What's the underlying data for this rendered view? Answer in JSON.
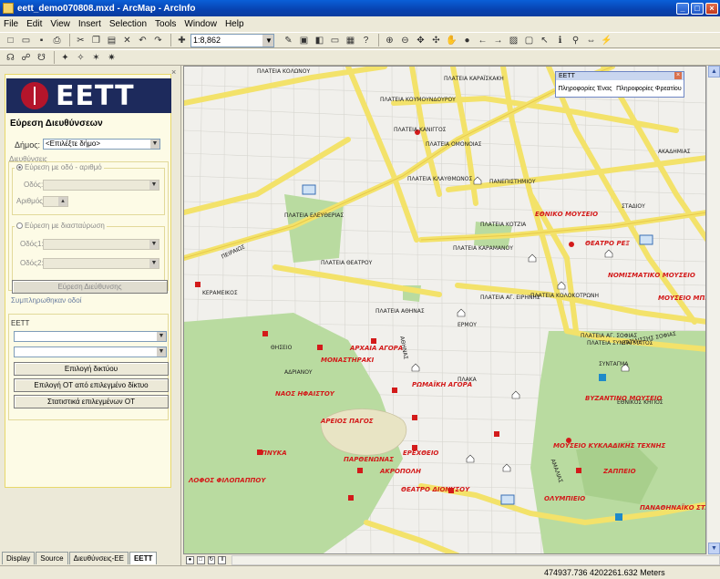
{
  "window": {
    "title": "eett_demo070808.mxd - ArcMap - ArcInfo"
  },
  "menu": [
    "File",
    "Edit",
    "View",
    "Insert",
    "Selection",
    "Tools",
    "Window",
    "Help"
  ],
  "toolbar": {
    "scale_value": "1:8,862"
  },
  "panel": {
    "logo_text": "EETT",
    "search_title": "Εύρεση Διευθύνσεων",
    "dimos_label": "Δήμος:",
    "dimos_value": "<Επιλέξτε δήμο>",
    "addresses_legend": "Διευθύνσεις",
    "by_street_legend": "Εύρεση με οδό - αριθμό",
    "odos_label": "Οδός:",
    "arithmos_label": "Αριθμός:",
    "by_cross_legend": "Εύρεση με διασταύρωση",
    "odos1_label": "Οδός1:",
    "odos2_label": "Οδός2:",
    "search_button": "Εύρεση Διεύθυνσης",
    "complete_link": "Συμπληρωθηκαν οδοί",
    "eett_section": "ΕΕΤΤ",
    "btn_network": "Επιλογή δικτύου",
    "btn_ot": "Επιλογή ΟΤ από επιλεγμένο δίκτυο",
    "btn_stats": "Στατιστικά επιλεγμένων ΟΤ"
  },
  "tabs": [
    "Display",
    "Source",
    "Διευθύνσεις-ΕΕ",
    "ΕΕΤΤ"
  ],
  "infobox": {
    "title": "ΕΕΤΤ",
    "item1": "Πληροφορίες Ένας",
    "item2": "Πληροφορίες Φρεατίου"
  },
  "status": {
    "coords": "474937.736  4202261.632 Meters"
  },
  "map": {
    "labels": [
      "ΠΛΑΤΕΙΑ ΚΟΛΩΝΟΥ",
      "ΠΛΑΤΕΙΑ ΚΑΡΑΪΣΚΑΚΗ",
      "ΠΛΑΤΕΙΑ ΚΟΥΜΟΥΝΔΟΥΡΟΥ",
      "ΠΛΑΤΕΙΑ ΟΜΟΝΟΙΑΣ",
      "ΠΛΑΤΕΙΑ ΕΛΕΥΘΕΡΙΑΣ",
      "ΠΛΑΤΕΙΑ ΚΑΡΑΜΑΝΟΥ",
      "ΠΛΑΤΕΙΑ ΘΕΑΤΡΟΥ",
      "ΠΛΑΤΕΙΑ ΚΟΤΖΙΑ",
      "ΠΛΑΤΕΙΑ ΚΟΛΟΚΟΤΡΩΝΗ",
      "ΠΛΑΤΕΙΑ ΑΓ. ΕΙΡΗΝΗΣ",
      "ΠΛΑΤΕΙΑ ΚΛΑΥΘΜΩΝΟΣ",
      "ΠΛΑΤΕΙΑ ΣΥΝΤΑΓΜΑΤΟΣ",
      "ΠΛΑΤΕΙΑ ΚΑΝΙΓΓΟΣ",
      "ΠΛΑΤΕΙΑ ΑΘΗΝΑΣ",
      "ΠΛΑΤΕΙΑ ΑΓ. ΣΟΦΙΑΣ",
      "ΣΥΝΤΑΓΜΑ",
      "ΕΡΜΟΥ",
      "ΑΘΗΝΑΣ",
      "ΠΕΙΡΑΙΩΣ",
      "ΣΤΑΔΙΟΥ",
      "ΠΑΝΕΠΙΣΤΗΜΙΟΥ",
      "ΑΚΑΔΗΜΙΑΣ",
      "ΑΜΑΛΙΑΣ",
      "ΒΑΣΙΛΙΣΣΗΣ ΣΟΦΙΑΣ",
      "ΕΘΝΙΚΟΣ ΚΗΠΟΣ",
      "ΠΛΑΚΑ",
      "ΑΔΡΙΑΝΟΥ",
      "ΚΕΡΑΜΕΙΚΟΣ",
      "ΘΗΣΕΙΟ"
    ],
    "pois": [
      "ΕΘΝΙΚΟ ΜΟΥΣΕΙΟ",
      "ΘΕΑΤΡΟ ΡΕΞ",
      "ΝΟΜΙΣΜΑΤΙΚΟ ΜΟΥΣΕΙΟ",
      "ΑΡΧΑΙΑ ΑΓΟΡΑ",
      "ΑΚΡΟΠΟΛΗ",
      "ΘΕΑΤΡΟ ΔΙΟΝΥΣΟΥ",
      "ΛΟΦΟΣ ΦΙΛΟΠΑΠΠΟΥ",
      "ΜΟΥΣΕΙΟ ΜΠΕΝΑΚΗ",
      "ΒΥΖΑΝΤΙΝΟ ΜΟΥΣΕΙΟ",
      "ΠΑΝΑΘΗΝΑΪΚΟ ΣΤΑΔΙΟ",
      "ΡΩΜΑΪΚΗ ΑΓΟΡΑ",
      "ΜΟΝΑΣΤΗΡΑΚΙ",
      "ΝΑΟΣ ΗΦΑΙΣΤΟΥ",
      "ΠΝΥΚΑ",
      "ΑΡΕΙΟΣ ΠΑΓΟΣ",
      "ΕΡΕΧΘΕΙΟ",
      "ΠΑΡΘΕΝΩΝΑΣ",
      "ΟΛΥΜΠΙΕΙΟ",
      "ΖΑΠΠΕΙΟ",
      "ΜΟΥΣΕΙΟ ΚΥΚΛΑΔΙΚΗΣ ΤΕΧΝΗΣ"
    ]
  },
  "colors": {
    "road": "#f3e26a",
    "park": "#b9dba0",
    "poi": "#d31a1a",
    "titlebar": "#0a5fd8"
  }
}
